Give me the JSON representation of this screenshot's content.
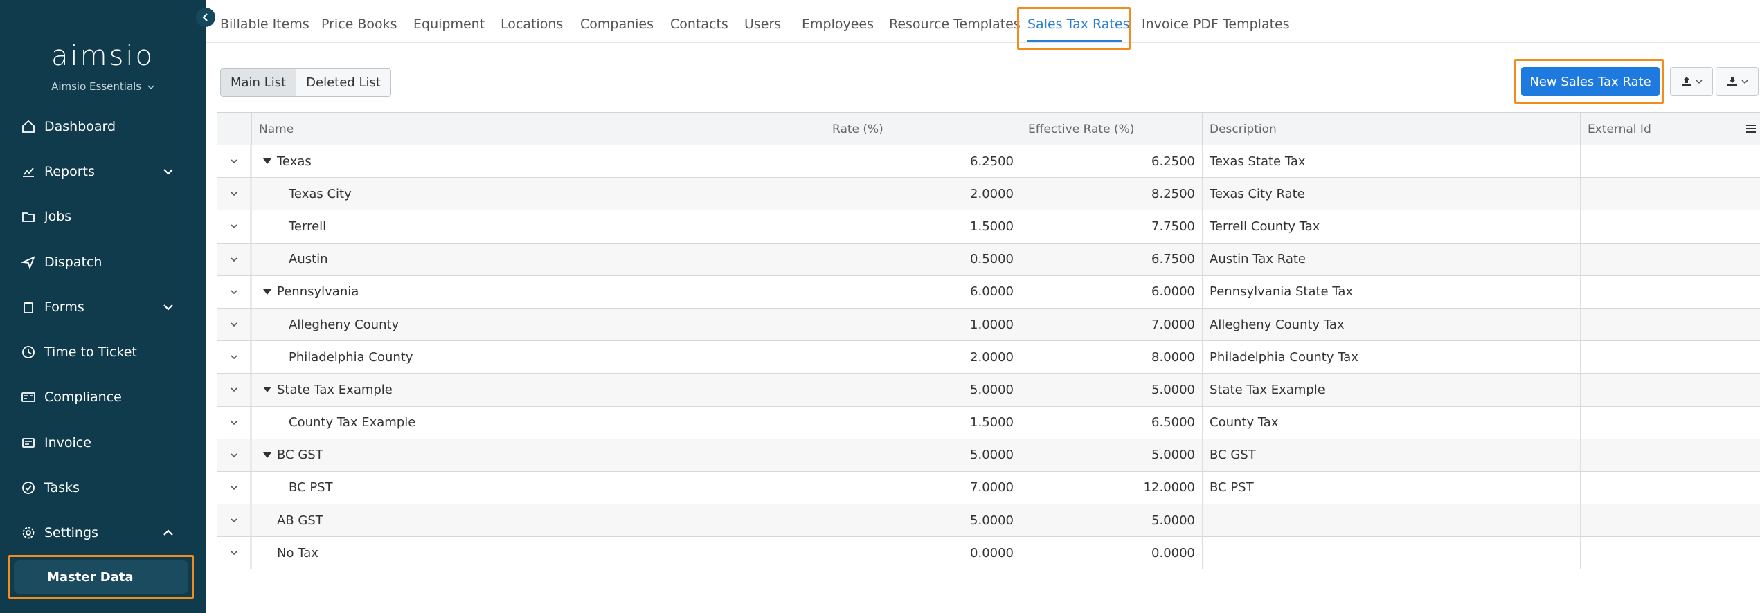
{
  "sidebar": {
    "logo_text": "aimsio",
    "org_name": "Aimsio Essentials",
    "items": [
      {
        "label": "Dashboard",
        "icon": "home-icon",
        "has_chevron": false
      },
      {
        "label": "Reports",
        "icon": "chart-icon",
        "has_chevron": true,
        "chevron": "down"
      },
      {
        "label": "Jobs",
        "icon": "folder-icon",
        "has_chevron": false
      },
      {
        "label": "Dispatch",
        "icon": "send-icon",
        "has_chevron": false
      },
      {
        "label": "Forms",
        "icon": "clipboard-icon",
        "has_chevron": true,
        "chevron": "down"
      },
      {
        "label": "Time to Ticket",
        "icon": "clock-icon",
        "has_chevron": false
      },
      {
        "label": "Compliance",
        "icon": "id-card-icon",
        "has_chevron": false
      },
      {
        "label": "Invoice",
        "icon": "invoice-icon",
        "has_chevron": false
      },
      {
        "label": "Tasks",
        "icon": "check-circle-icon",
        "has_chevron": false
      },
      {
        "label": "Settings",
        "icon": "gear-icon",
        "has_chevron": true,
        "chevron": "up"
      }
    ],
    "subitem": "Master Data"
  },
  "tabs": [
    "Billable Items",
    "Price Books",
    "Equipment",
    "Locations",
    "Companies",
    "Contacts",
    "Users",
    "Employees",
    "Resource Templates",
    "Sales Tax Rates",
    "Invoice PDF Templates"
  ],
  "active_tab": "Sales Tax Rates",
  "toolbar": {
    "main_list": "Main List",
    "deleted_list": "Deleted List",
    "new_button": "New Sales Tax Rate"
  },
  "grid": {
    "columns": [
      "Name",
      "Rate (%)",
      "Effective Rate (%)",
      "Description",
      "External Id"
    ],
    "rows": [
      {
        "name": "Texas",
        "level": 0,
        "group": true,
        "rate": "6.2500",
        "effective": "6.2500",
        "description": "Texas State Tax"
      },
      {
        "name": "Texas City",
        "level": 1,
        "group": false,
        "rate": "2.0000",
        "effective": "8.2500",
        "description": "Texas City Rate"
      },
      {
        "name": "Terrell",
        "level": 1,
        "group": false,
        "rate": "1.5000",
        "effective": "7.7500",
        "description": "Terrell County Tax"
      },
      {
        "name": "Austin",
        "level": 1,
        "group": false,
        "rate": "0.5000",
        "effective": "6.7500",
        "description": "Austin Tax Rate"
      },
      {
        "name": "Pennsylvania",
        "level": 0,
        "group": true,
        "rate": "6.0000",
        "effective": "6.0000",
        "description": "Pennsylvania State Tax"
      },
      {
        "name": "Allegheny County",
        "level": 1,
        "group": false,
        "rate": "1.0000",
        "effective": "7.0000",
        "description": "Allegheny County Tax"
      },
      {
        "name": "Philadelphia County",
        "level": 1,
        "group": false,
        "rate": "2.0000",
        "effective": "8.0000",
        "description": "Philadelphia County Tax"
      },
      {
        "name": "State Tax Example",
        "level": 0,
        "group": true,
        "rate": "5.0000",
        "effective": "5.0000",
        "description": "State Tax Example"
      },
      {
        "name": "County Tax Example",
        "level": 1,
        "group": false,
        "rate": "1.5000",
        "effective": "6.5000",
        "description": "County Tax"
      },
      {
        "name": "BC GST",
        "level": 0,
        "group": true,
        "rate": "5.0000",
        "effective": "5.0000",
        "description": "BC GST"
      },
      {
        "name": "BC PST",
        "level": 1,
        "group": false,
        "rate": "7.0000",
        "effective": "12.0000",
        "description": "BC PST"
      },
      {
        "name": "AB GST",
        "level": 0,
        "group": false,
        "rate": "5.0000",
        "effective": "5.0000",
        "description": ""
      },
      {
        "name": "No Tax",
        "level": 0,
        "group": false,
        "rate": "0.0000",
        "effective": "0.0000",
        "description": ""
      }
    ]
  },
  "colors": {
    "sidebar_bg": "#0f3b4d",
    "accent": "#1f7ae0",
    "highlight": "#f28c1f"
  }
}
